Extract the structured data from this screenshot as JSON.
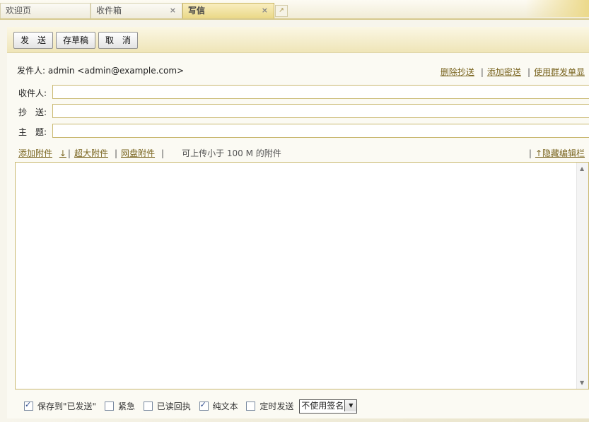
{
  "tabs": [
    {
      "label": "欢迎页",
      "close": ""
    },
    {
      "label": "收件箱",
      "close": "×"
    },
    {
      "label": "写信",
      "close": "×"
    }
  ],
  "new_tab_icon": "↗",
  "toolbar": {
    "send": "发　送",
    "save_draft": "存草稿",
    "cancel": "取　消"
  },
  "sender": {
    "label": "发件人:",
    "value": "admin <admin@example.com>"
  },
  "top_links": [
    "删除抄送",
    "添加密送",
    "使用群发单显"
  ],
  "fields": {
    "to_label": "收件人",
    "cc_label": "抄　送",
    "subject_label": "主　题",
    "colon": ":"
  },
  "attach": {
    "add": "添加附件",
    "arrow": "↓",
    "big": "超大附件",
    "netdisk": "网盘附件",
    "note": "可上传小于 100 M 的附件",
    "hide_editor": "↑隐藏编辑栏"
  },
  "bottom": {
    "save_sent": "保存到\"已发送\"",
    "urgent": "紧急",
    "read_receipt": "已读回执",
    "plain_text": "纯文本",
    "scheduled": "定时发送",
    "signature": "不使用签名"
  },
  "states": {
    "save_sent": true,
    "urgent": false,
    "read_receipt": false,
    "plain_text": true,
    "scheduled": false
  }
}
